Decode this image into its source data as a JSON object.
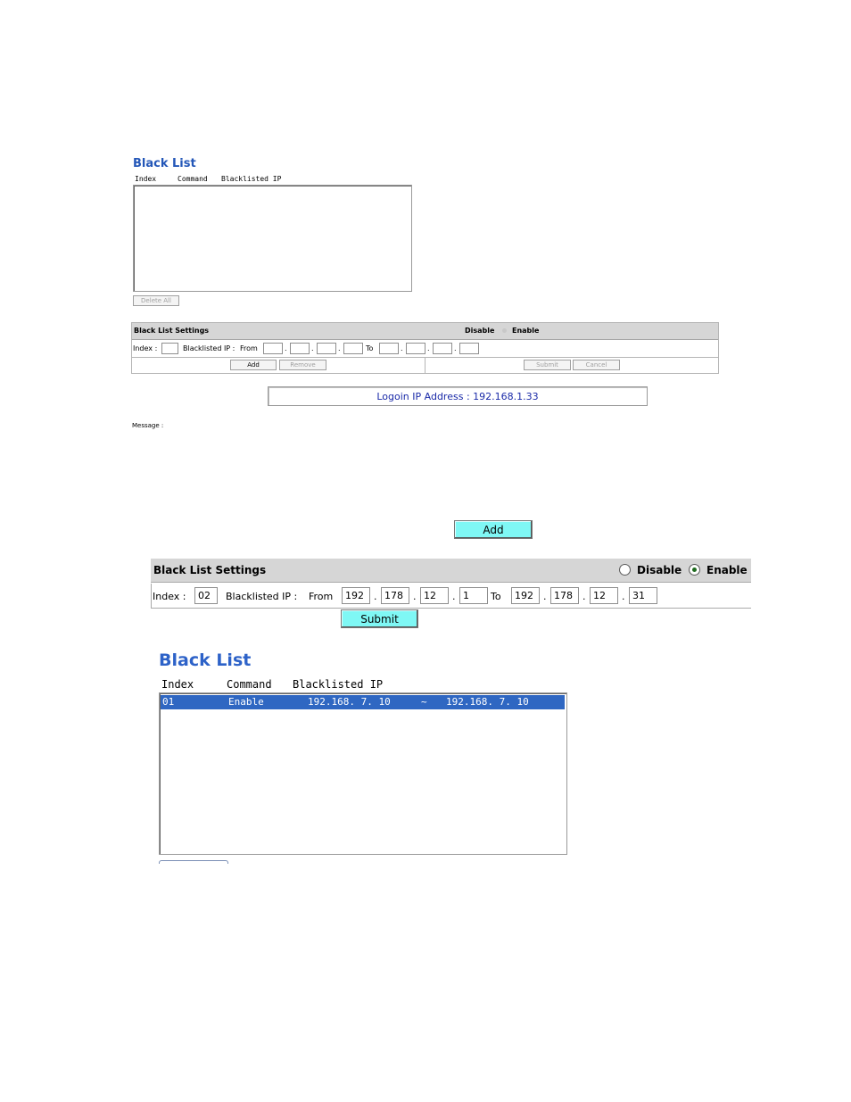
{
  "top_view": {
    "title": "Black List",
    "columns": [
      "Index",
      "Command",
      "Blacklisted IP"
    ],
    "delete_all_label": "Delete All",
    "settings": {
      "title": "Black List Settings",
      "disable_label": "Disable",
      "enable_label": "Enable",
      "index_label": "Index :",
      "blacklisted_ip_label": "Blacklisted IP :",
      "from_label": "From",
      "to_label": "To",
      "add_label": "Add",
      "remove_label": "Remove",
      "submit_label": "Submit",
      "cancel_label": "Cancel"
    },
    "login_ip": "Logoin IP Address : 192.168.1.33",
    "message_label": "Message :"
  },
  "zoom_view": {
    "add_label": "Add",
    "settings": {
      "title": "Black List Settings",
      "disable_label": "Disable",
      "enable_label": "Enable",
      "selected_mode": "Enable",
      "index_label": "Index :",
      "index_value": "02",
      "blacklisted_ip_label": "Blacklisted IP :",
      "from_label": "From",
      "to_label": "To",
      "from_ip": [
        "192",
        "178",
        "12",
        "1"
      ],
      "to_ip": [
        "192",
        "178",
        "12",
        "31"
      ]
    },
    "submit_label": "Submit",
    "list": {
      "title": "Black List",
      "columns": [
        "Index",
        "Command",
        "Blacklisted IP"
      ],
      "rows": [
        {
          "index": "01",
          "command": "Enable",
          "from": "192.168. 7. 10",
          "sep": "~",
          "to": "192.168. 7. 10"
        }
      ]
    }
  },
  "colors": {
    "title_blue": "#2d62c8",
    "button_cyan": "#7ff8f5",
    "selection_blue": "#2f67c2",
    "header_gray": "#d6d6d6"
  }
}
